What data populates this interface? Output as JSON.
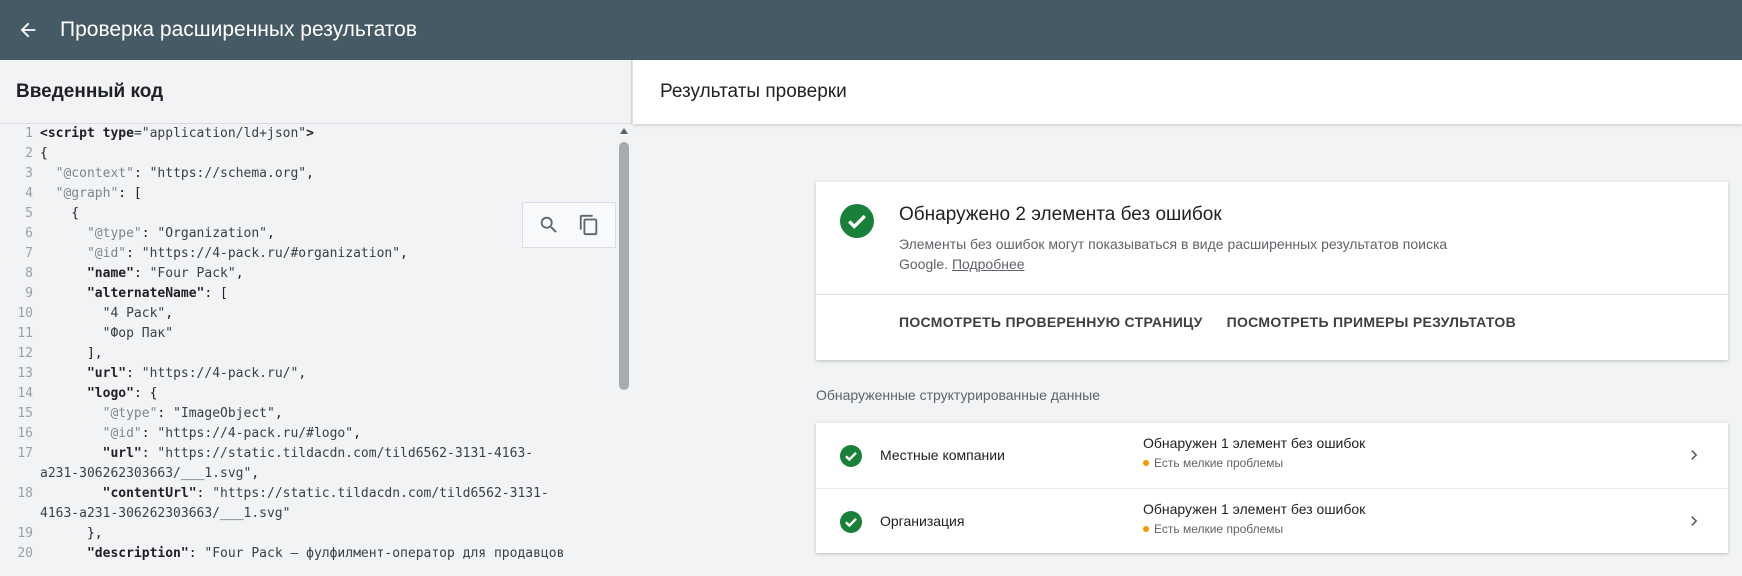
{
  "topbar": {
    "title": "Проверка расширенных результатов"
  },
  "left": {
    "header": "Введенный код",
    "code_lines": [
      {
        "n": "1",
        "parts": [
          [
            "tag",
            "<script "
          ],
          [
            "tag",
            "type"
          ],
          [
            "str",
            "=\"application/ld+json\""
          ],
          [
            "tag",
            ">"
          ]
        ]
      },
      {
        "n": "2",
        "parts": [
          [
            "plain",
            "{"
          ]
        ]
      },
      {
        "n": "3",
        "parts": [
          [
            "plain",
            "  "
          ],
          [
            "meta",
            "\"@context\""
          ],
          [
            "plain",
            ": "
          ],
          [
            "str",
            "\"https://schema.org\""
          ],
          [
            "plain",
            ","
          ]
        ]
      },
      {
        "n": "4",
        "parts": [
          [
            "plain",
            "  "
          ],
          [
            "meta",
            "\"@graph\""
          ],
          [
            "plain",
            ": ["
          ]
        ]
      },
      {
        "n": "5",
        "parts": [
          [
            "plain",
            "    {"
          ]
        ]
      },
      {
        "n": "6",
        "parts": [
          [
            "plain",
            "      "
          ],
          [
            "meta",
            "\"@type\""
          ],
          [
            "plain",
            ": "
          ],
          [
            "str",
            "\"Organization\""
          ],
          [
            "plain",
            ","
          ]
        ]
      },
      {
        "n": "7",
        "parts": [
          [
            "plain",
            "      "
          ],
          [
            "meta",
            "\"@id\""
          ],
          [
            "plain",
            ": "
          ],
          [
            "str",
            "\"https://4-pack.ru/#organization\""
          ],
          [
            "plain",
            ","
          ]
        ]
      },
      {
        "n": "8",
        "parts": [
          [
            "plain",
            "      "
          ],
          [
            "key",
            "\"name\""
          ],
          [
            "plain",
            ": "
          ],
          [
            "str",
            "\"Four Pack\""
          ],
          [
            "plain",
            ","
          ]
        ]
      },
      {
        "n": "9",
        "parts": [
          [
            "plain",
            "      "
          ],
          [
            "key",
            "\"alternateName\""
          ],
          [
            "plain",
            ": ["
          ]
        ]
      },
      {
        "n": "10",
        "parts": [
          [
            "plain",
            "        "
          ],
          [
            "str",
            "\"4 Pack\""
          ],
          [
            "plain",
            ","
          ]
        ]
      },
      {
        "n": "11",
        "parts": [
          [
            "plain",
            "        "
          ],
          [
            "str",
            "\"Фор Пак\""
          ]
        ]
      },
      {
        "n": "12",
        "parts": [
          [
            "plain",
            "      ],"
          ]
        ]
      },
      {
        "n": "13",
        "parts": [
          [
            "plain",
            "      "
          ],
          [
            "key",
            "\"url\""
          ],
          [
            "plain",
            ": "
          ],
          [
            "str",
            "\"https://4-pack.ru/\""
          ],
          [
            "plain",
            ","
          ]
        ]
      },
      {
        "n": "14",
        "parts": [
          [
            "plain",
            "      "
          ],
          [
            "key",
            "\"logo\""
          ],
          [
            "plain",
            ": {"
          ]
        ]
      },
      {
        "n": "15",
        "parts": [
          [
            "plain",
            "        "
          ],
          [
            "meta",
            "\"@type\""
          ],
          [
            "plain",
            ": "
          ],
          [
            "str",
            "\"ImageObject\""
          ],
          [
            "plain",
            ","
          ]
        ]
      },
      {
        "n": "16",
        "parts": [
          [
            "plain",
            "        "
          ],
          [
            "meta",
            "\"@id\""
          ],
          [
            "plain",
            ": "
          ],
          [
            "str",
            "\"https://4-pack.ru/#logo\""
          ],
          [
            "plain",
            ","
          ]
        ]
      },
      {
        "n": "17",
        "parts": [
          [
            "plain",
            "        "
          ],
          [
            "key",
            "\"url\""
          ],
          [
            "plain",
            ": "
          ],
          [
            "str",
            "\"https://static.tildacdn.com/tild6562-3131-4163-"
          ]
        ]
      },
      {
        "n": "",
        "parts": [
          [
            "str",
            "a231-306262303663/___1.svg\""
          ],
          [
            "plain",
            ","
          ]
        ]
      },
      {
        "n": "18",
        "parts": [
          [
            "plain",
            "        "
          ],
          [
            "key",
            "\"contentUrl\""
          ],
          [
            "plain",
            ": "
          ],
          [
            "str",
            "\"https://static.tildacdn.com/tild6562-3131-"
          ]
        ]
      },
      {
        "n": "",
        "parts": [
          [
            "str",
            "4163-a231-306262303663/___1.svg\""
          ]
        ]
      },
      {
        "n": "19",
        "parts": [
          [
            "plain",
            "      },"
          ]
        ]
      },
      {
        "n": "20",
        "parts": [
          [
            "plain",
            "      "
          ],
          [
            "key",
            "\"description\""
          ],
          [
            "plain",
            ": "
          ],
          [
            "str",
            "\"Four Pack — фулфилмент-оператор для продавцов"
          ]
        ]
      }
    ]
  },
  "right": {
    "header": "Результаты проверки",
    "summary": {
      "title": "Обнаружено 2 элемента без ошибок",
      "desc": "Элементы без ошибок могут показываться в виде расширенных результатов поиска Google.",
      "link": "Подробнее",
      "action1": "ПОСМОТРЕТЬ ПРОВЕРЕННУЮ СТРАНИЦУ",
      "action2": "ПОСМОТРЕТЬ ПРИМЕРЫ РЕЗУЛЬТАТОВ"
    },
    "section_label": "Обнаруженные структурированные данные",
    "items": [
      {
        "name": "Местные компании",
        "status": "Обнаружен 1 элемент без ошибок",
        "sub": "Есть мелкие проблемы"
      },
      {
        "name": "Организация",
        "status": "Обнаружен 1 элемент без ошибок",
        "sub": "Есть мелкие проблемы"
      }
    ]
  },
  "colors": {
    "topbar": "#455a64",
    "success": "#188038",
    "warning": "#f29900"
  }
}
